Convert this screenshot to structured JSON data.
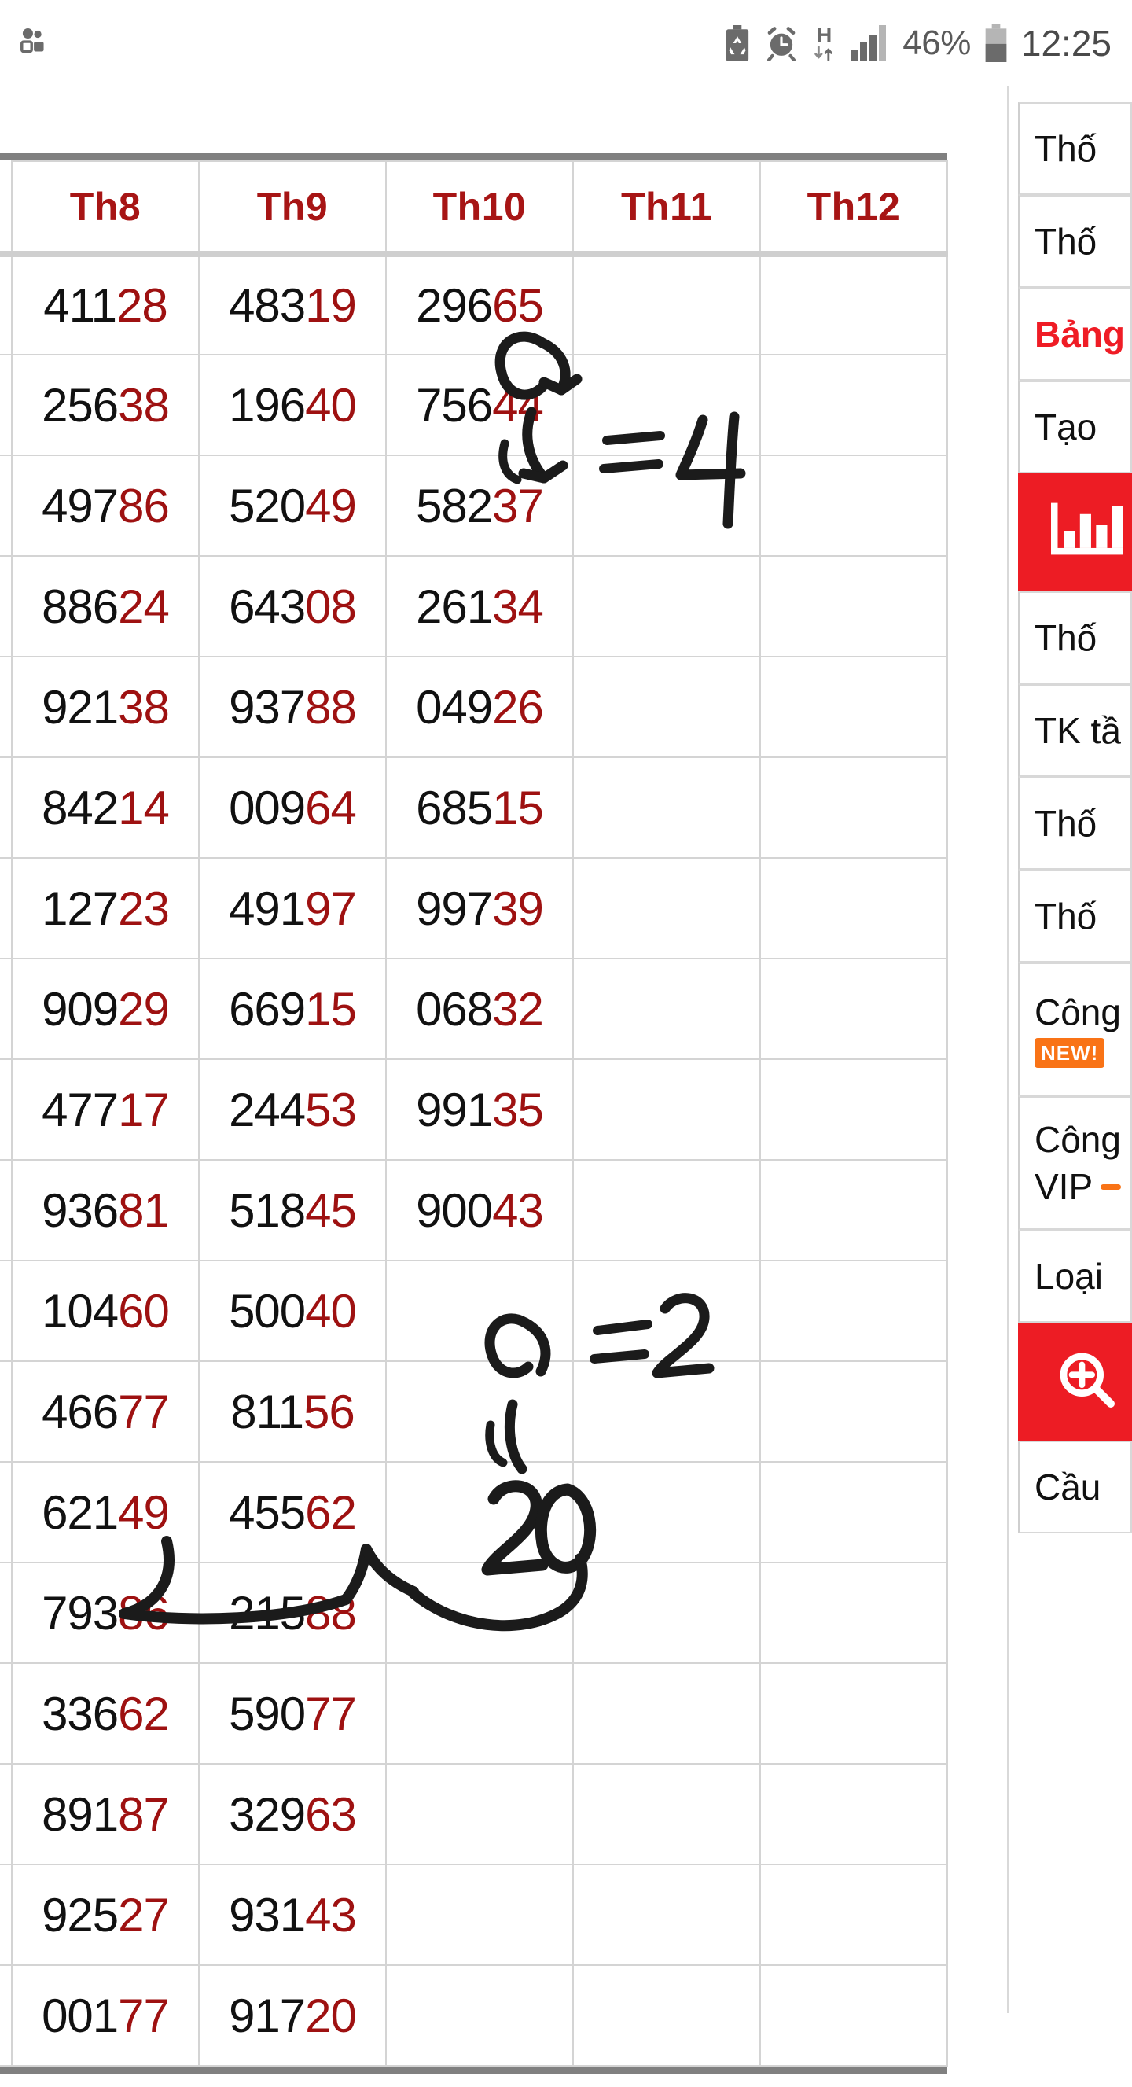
{
  "status_bar": {
    "left_icons": [
      "screen-recorder-icon"
    ],
    "right_icons": [
      "battery-saver-icon",
      "alarm-clock-icon",
      "hspa-data-icon",
      "signal-bars-icon",
      "battery-icon"
    ],
    "network_label": "H",
    "battery_percent": "46%",
    "time": "12:25"
  },
  "table": {
    "headers": [
      "",
      "Th8",
      "Th9",
      "Th10",
      "Th11",
      "Th12"
    ],
    "rows": [
      {
        "cells": [
          {
            "text": "",
            "fill": "green"
          },
          {
            "head": "411",
            "tail": "28",
            "fill": "none"
          },
          {
            "head": "483",
            "tail": "19",
            "fill": "none"
          },
          {
            "head": "296",
            "tail": "65",
            "fill": "orange"
          },
          {
            "text": "",
            "fill": "none"
          },
          {
            "text": "",
            "fill": "none"
          }
        ]
      },
      {
        "cells": [
          {
            "text": "",
            "fill": "none"
          },
          {
            "head": "256",
            "tail": "38",
            "fill": "none"
          },
          {
            "head": "196",
            "tail": "40",
            "fill": "green"
          },
          {
            "head": "756",
            "tail": "44",
            "fill": "orange"
          },
          {
            "text": "",
            "fill": "none"
          },
          {
            "text": "",
            "fill": "green"
          }
        ]
      },
      {
        "cells": [
          {
            "text": "",
            "fill": "none"
          },
          {
            "head": "497",
            "tail": "86",
            "fill": "none"
          },
          {
            "head": "520",
            "tail": "49",
            "fill": "none"
          },
          {
            "head": "582",
            "tail": "37",
            "fill": "none"
          },
          {
            "text": "",
            "fill": "none"
          },
          {
            "text": "",
            "fill": "none"
          }
        ]
      },
      {
        "cells": [
          {
            "text": "",
            "fill": "none"
          },
          {
            "head": "886",
            "tail": "24",
            "fill": "none"
          },
          {
            "head": "643",
            "tail": "08",
            "fill": "none"
          },
          {
            "head": "261",
            "tail": "34",
            "fill": "none"
          },
          {
            "text": "",
            "fill": "green"
          },
          {
            "text": "",
            "fill": "none"
          }
        ]
      },
      {
        "cells": [
          {
            "text": "",
            "fill": "green"
          },
          {
            "head": "921",
            "tail": "38",
            "fill": "green"
          },
          {
            "head": "937",
            "tail": "88",
            "fill": "none"
          },
          {
            "head": "049",
            "tail": "26",
            "fill": "none"
          },
          {
            "text": "",
            "fill": "none"
          },
          {
            "text": "",
            "fill": "none"
          }
        ]
      },
      {
        "cells": [
          {
            "text": "",
            "fill": "none"
          },
          {
            "head": "842",
            "tail": "14",
            "fill": "none"
          },
          {
            "head": "009",
            "tail": "64",
            "fill": "none"
          },
          {
            "head": "685",
            "tail": "15",
            "fill": "none"
          },
          {
            "text": "",
            "fill": "none"
          },
          {
            "text": "",
            "fill": "none"
          }
        ]
      },
      {
        "cells": [
          {
            "text": "",
            "fill": "none"
          },
          {
            "head": "127",
            "tail": "23",
            "fill": "none"
          },
          {
            "head": "491",
            "tail": "97",
            "fill": "none"
          },
          {
            "head": "997",
            "tail": "39",
            "fill": "green"
          },
          {
            "text": "",
            "fill": "none"
          },
          {
            "text": "",
            "fill": "none"
          }
        ]
      },
      {
        "cells": [
          {
            "text": "",
            "fill": "green"
          },
          {
            "head": "909",
            "tail": "29",
            "fill": "none"
          },
          {
            "head": "669",
            "tail": "15",
            "fill": "none"
          },
          {
            "head": "068",
            "tail": "32",
            "fill": "none"
          },
          {
            "text": "",
            "fill": "none"
          },
          {
            "text": "",
            "fill": "none"
          }
        ]
      },
      {
        "cells": [
          {
            "text": "",
            "fill": "none"
          },
          {
            "head": "477",
            "tail": "17",
            "fill": "none"
          },
          {
            "head": "244",
            "tail": "53",
            "fill": "green"
          },
          {
            "head": "991",
            "tail": "35",
            "fill": "none"
          },
          {
            "text": "",
            "fill": "none"
          },
          {
            "text": "",
            "fill": "green"
          }
        ]
      },
      {
        "cells": [
          {
            "text": "",
            "fill": "none"
          },
          {
            "head": "936",
            "tail": "81",
            "fill": "none"
          },
          {
            "head": "518",
            "tail": "45",
            "fill": "none"
          },
          {
            "head": "900",
            "tail": "43",
            "fill": "none"
          },
          {
            "text": "",
            "fill": "none"
          },
          {
            "text": "",
            "fill": "none"
          }
        ]
      },
      {
        "cells": [
          {
            "text": "",
            "fill": "orange"
          },
          {
            "head": "104",
            "tail": "60",
            "fill": "orange"
          },
          {
            "head": "500",
            "tail": "40",
            "fill": "orange"
          },
          {
            "head": "",
            "tail": "",
            "fill": "orange"
          },
          {
            "text": "",
            "fill": "green"
          },
          {
            "text": "",
            "fill": "none"
          }
        ]
      },
      {
        "cells": [
          {
            "text": "",
            "fill": "green"
          },
          {
            "head": "466",
            "tail": "77",
            "fill": "green"
          },
          {
            "head": "811",
            "tail": "56",
            "fill": "none"
          },
          {
            "text": "",
            "fill": "none"
          },
          {
            "text": "",
            "fill": "none"
          },
          {
            "text": "",
            "fill": "none"
          }
        ]
      },
      {
        "cells": [
          {
            "text": "",
            "fill": "none"
          },
          {
            "head": "621",
            "tail": "49",
            "fill": "none"
          },
          {
            "head": "455",
            "tail": "62",
            "fill": "none"
          },
          {
            "text": "",
            "fill": "none"
          },
          {
            "text": "",
            "fill": "none"
          },
          {
            "text": "",
            "fill": "none"
          }
        ]
      },
      {
        "cells": [
          {
            "text": "",
            "fill": "none"
          },
          {
            "head": "793",
            "tail": "86",
            "fill": "none"
          },
          {
            "head": "215",
            "tail": "88",
            "fill": "none"
          },
          {
            "text": "",
            "fill": "green"
          },
          {
            "text": "",
            "fill": "none"
          },
          {
            "text": "",
            "fill": "none"
          }
        ]
      },
      {
        "cells": [
          {
            "text": "",
            "fill": "green"
          },
          {
            "head": "336",
            "tail": "62",
            "fill": "none"
          },
          {
            "head": "590",
            "tail": "77",
            "fill": "none"
          },
          {
            "text": "",
            "fill": "none"
          },
          {
            "text": "",
            "fill": "none"
          },
          {
            "text": "",
            "fill": "none"
          }
        ]
      },
      {
        "cells": [
          {
            "text": "",
            "fill": "none"
          },
          {
            "head": "891",
            "tail": "87",
            "fill": "none"
          },
          {
            "head": "329",
            "tail": "63",
            "fill": "green"
          },
          {
            "text": "",
            "fill": "none"
          },
          {
            "text": "",
            "fill": "none"
          },
          {
            "text": "",
            "fill": "green"
          }
        ]
      },
      {
        "cells": [
          {
            "text": "",
            "fill": "none"
          },
          {
            "head": "925",
            "tail": "27",
            "fill": "none"
          },
          {
            "head": "931",
            "tail": "43",
            "fill": "none"
          },
          {
            "text": "",
            "fill": "none"
          },
          {
            "text": "",
            "fill": "none"
          },
          {
            "text": "",
            "fill": "none"
          }
        ]
      },
      {
        "cells": [
          {
            "text": "",
            "fill": "none"
          },
          {
            "head": "001",
            "tail": "77",
            "fill": "none"
          },
          {
            "head": "917",
            "tail": "20",
            "fill": "none"
          },
          {
            "text": "",
            "fill": "none"
          },
          {
            "text": "",
            "fill": "green"
          },
          {
            "text": "",
            "fill": "none"
          }
        ]
      }
    ]
  },
  "annotations": [
    {
      "name": "equals-four",
      "text": "= 4"
    },
    {
      "name": "equals-two",
      "text": "= 2"
    },
    {
      "name": "twenty",
      "text": "20"
    }
  ],
  "sidebar": {
    "items": [
      {
        "label": "Thố",
        "type": "text"
      },
      {
        "label": "Thố",
        "type": "text"
      },
      {
        "label": "Bảng",
        "type": "text-red"
      },
      {
        "label": "Tạo",
        "type": "text"
      },
      {
        "label": "",
        "type": "chart-button"
      },
      {
        "label": "Thố",
        "type": "text"
      },
      {
        "label": "TK tầ",
        "type": "text"
      },
      {
        "label": "Thố",
        "type": "text"
      },
      {
        "label": "Thố",
        "type": "text"
      },
      {
        "label": "Công",
        "badge": "NEW!",
        "type": "text-badge"
      },
      {
        "label": "Công",
        "label2": "VIP",
        "type": "text-two"
      },
      {
        "label": "Loại",
        "type": "text"
      },
      {
        "label": "",
        "type": "zoom-button"
      },
      {
        "label": "Cầu",
        "type": "text"
      }
    ]
  },
  "colors": {
    "header_text": "#a71515",
    "tail_digits": "#9e1111",
    "highlight_orange": "#fcb712",
    "highlight_green": "#dfeedd",
    "accent_red": "#ed1c24",
    "badge_orange": "#f97316"
  }
}
